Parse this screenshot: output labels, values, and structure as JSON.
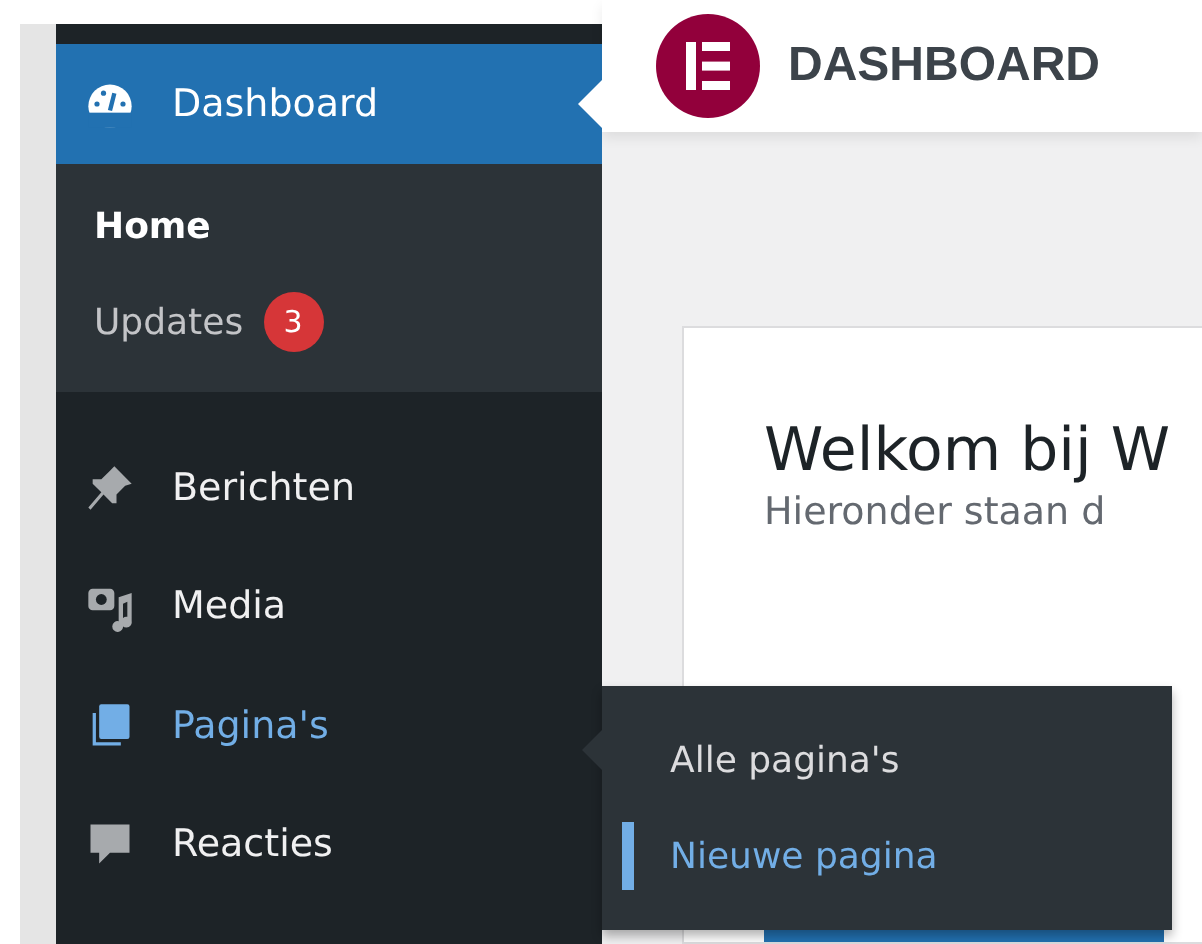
{
  "sidebar": {
    "items": [
      {
        "label": "Dashboard",
        "kind": "gauge",
        "selected": true,
        "children": [
          {
            "label": "Home",
            "selected": true
          },
          {
            "label": "Updates",
            "badge": "3",
            "selected": false
          }
        ]
      },
      {
        "label": "Berichten",
        "kind": "pin",
        "selected": false
      },
      {
        "label": "Media",
        "kind": "media",
        "selected": false
      },
      {
        "label": "Pagina's",
        "kind": "pages",
        "selected": false,
        "hovered": true
      },
      {
        "label": "Reacties",
        "kind": "comment",
        "selected": false
      }
    ]
  },
  "flyout": {
    "items": [
      {
        "label": "Alle pagina's",
        "selected": false
      },
      {
        "label": "Nieuwe pagina",
        "selected": true
      }
    ]
  },
  "header": {
    "title": "DASHBOARD"
  },
  "welcome": {
    "heading": "Welkom bij W",
    "text": "Hieronder staan d"
  }
}
